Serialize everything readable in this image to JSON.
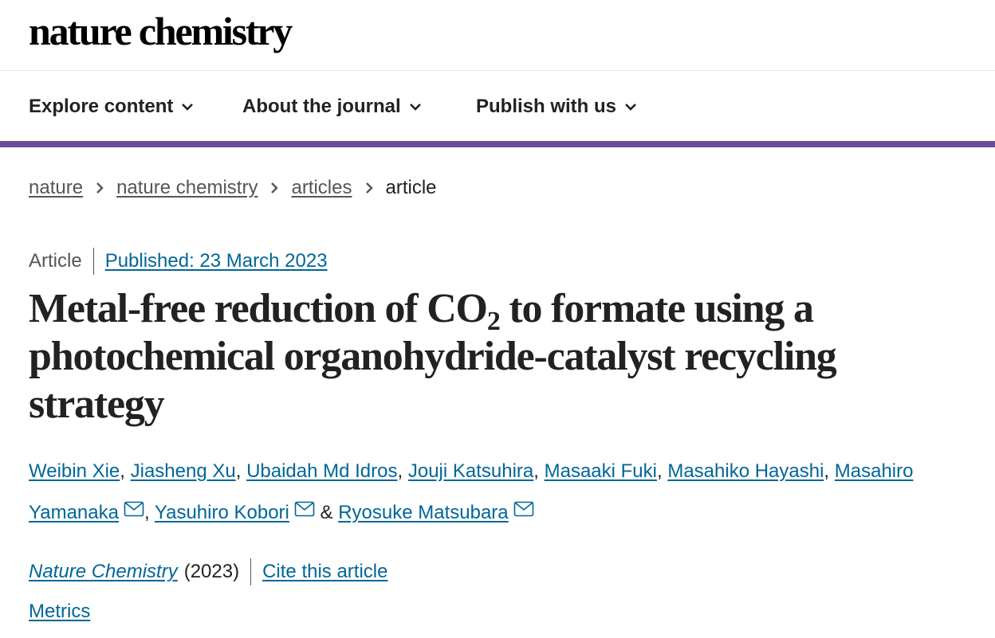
{
  "site": {
    "logo": "nature chemistry"
  },
  "nav": {
    "items": [
      {
        "label": "Explore content"
      },
      {
        "label": "About the journal"
      },
      {
        "label": "Publish with us"
      }
    ]
  },
  "colors": {
    "accent": "#6b4c9a",
    "link": "#006699",
    "text": "#222222",
    "muted": "#555555"
  },
  "breadcrumb": {
    "items": [
      {
        "label": "nature"
      },
      {
        "label": "nature chemistry"
      },
      {
        "label": "articles"
      }
    ],
    "current": "article"
  },
  "article": {
    "type": "Article",
    "published": "Published: 23 March 2023",
    "title_before": "Metal-free reduction of CO",
    "title_sub": "2",
    "title_after": " to formate using a photochemical organohydride-catalyst recycling strategy",
    "authors": [
      "Weibin Xie",
      "Jiasheng Xu",
      "Ubaidah Md Idros",
      "Jouji Katsuhira",
      "Masaaki Fuki",
      "Masahiko Hayashi",
      "Masahiro Yamanaka",
      "Yasuhiro Kobori",
      "Ryosuke Matsubara"
    ],
    "author_separator": ", ",
    "author_last_separator": " & ",
    "journal": "Nature Chemistry",
    "year": "(2023)",
    "cite_label": "Cite this article",
    "metrics_label": "Metrics"
  },
  "icons": {
    "dropdown": "chevron-down-icon",
    "breadcrumb": "chevron-right-icon",
    "contact": "envelope-icon"
  }
}
